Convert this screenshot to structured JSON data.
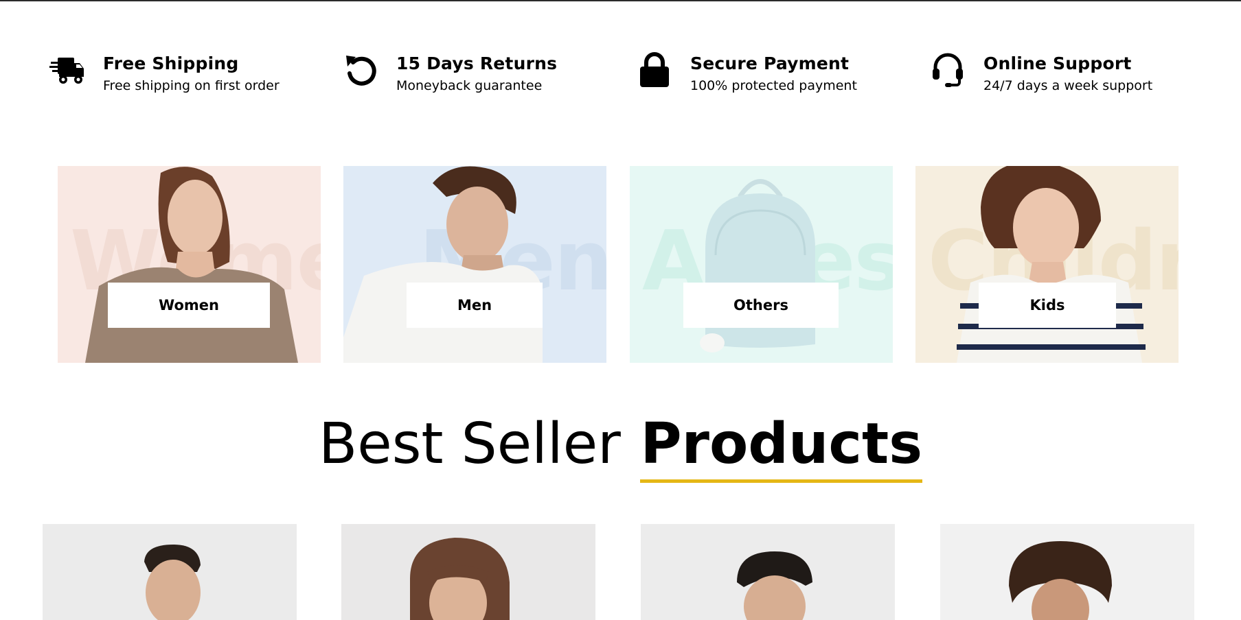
{
  "features": [
    {
      "icon": "truck-icon",
      "title": "Free Shipping",
      "subtitle": "Free shipping on first order"
    },
    {
      "icon": "return-icon",
      "title": "15 Days Returns",
      "subtitle": "Moneyback guarantee"
    },
    {
      "icon": "lock-icon",
      "title": "Secure Payment",
      "subtitle": "100% protected payment"
    },
    {
      "icon": "headset-icon",
      "title": "Online Support",
      "subtitle": "24/7 days a week support"
    }
  ],
  "categories": [
    {
      "label": "Women",
      "bg_word": "Women",
      "bg_color": "#f9e8e3",
      "word_color": "#f2dcd4"
    },
    {
      "label": "Men",
      "bg_word": "Mens",
      "bg_color": "#dfeaf6",
      "word_color": "#d0dfef"
    },
    {
      "label": "Others",
      "bg_word": "Accessories",
      "bg_color": "#e6f8f4",
      "word_color": "#d2f1e9"
    },
    {
      "label": "Kids",
      "bg_word": "Children",
      "bg_color": "#f6eedf",
      "word_color": "#efe3cb"
    }
  ],
  "heading": {
    "light": "Best Seller",
    "bold": "Products",
    "underline_color": "#e5b716"
  },
  "products": [
    {
      "image": "man-shaved-head"
    },
    {
      "image": "woman-curly-hair"
    },
    {
      "image": "man-dark-hair"
    },
    {
      "image": "child-curly-hair"
    }
  ]
}
